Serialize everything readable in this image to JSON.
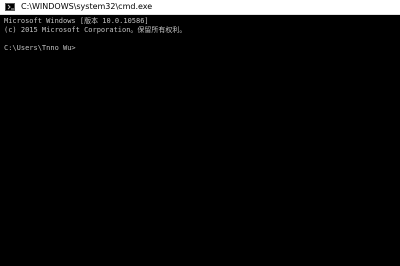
{
  "window": {
    "title": "C:\\WINDOWS\\system32\\cmd.exe",
    "icon": "cmd-icon"
  },
  "console": {
    "lines": [
      "Microsoft Windows [版本 10.0.10586]",
      "(c) 2015 Microsoft Corporation。保留所有权利。",
      "",
      "C:\\Users\\Tnno Wu>"
    ]
  },
  "colors": {
    "background": "#000000",
    "text": "#c0c0c0",
    "titlebar": "#ffffff"
  }
}
